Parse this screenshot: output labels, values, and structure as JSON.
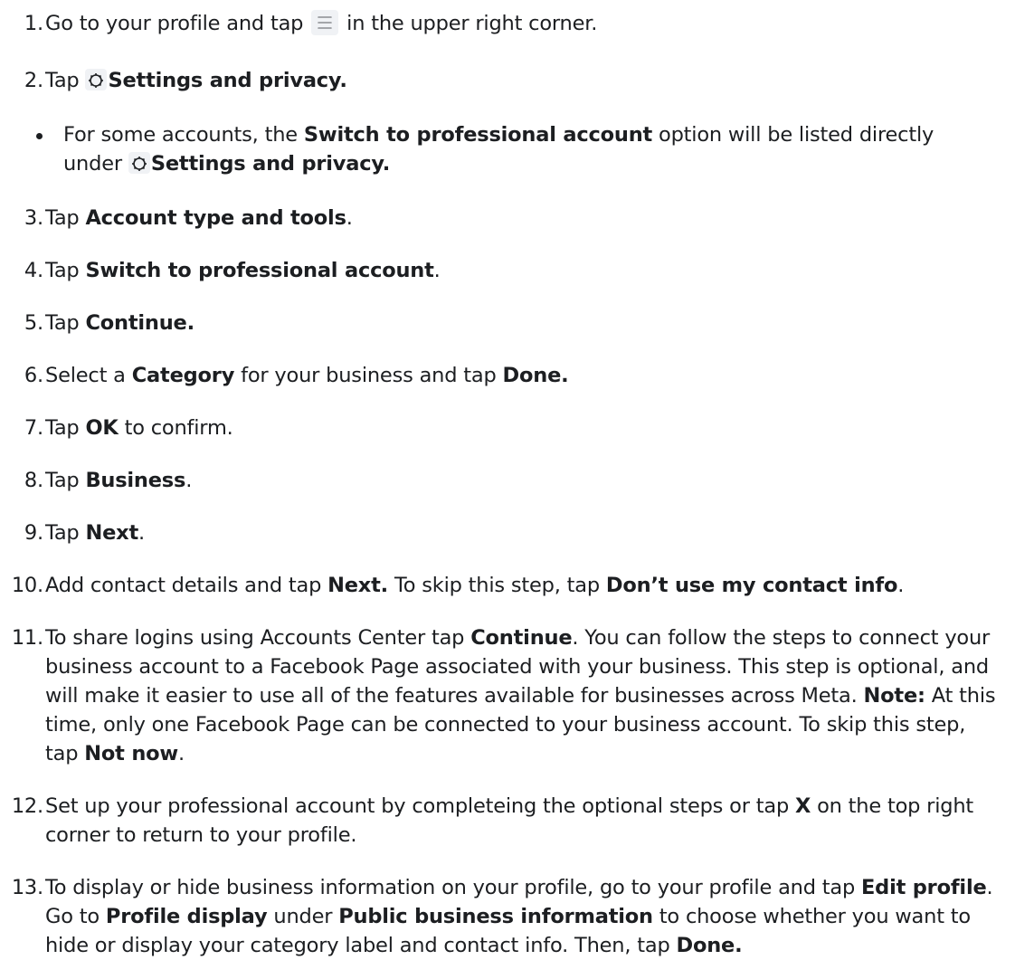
{
  "steps": [
    {
      "num": "1.",
      "a": "Go to your profile and tap ",
      "icon": "menu-icon",
      "b": " in the upper right corner."
    },
    {
      "num": "2.",
      "a": "Tap ",
      "icon": "gear-icon",
      "bold": "Settings and privacy."
    },
    {
      "num": "3.",
      "a": "Tap ",
      "bold": "Account type and tools",
      "b": "."
    },
    {
      "num": "4.",
      "a": "Tap ",
      "bold": "Switch to professional account",
      "b": "."
    },
    {
      "num": "5.",
      "a": "Tap ",
      "bold": "Continue."
    },
    {
      "num": "6.",
      "a": "Select a ",
      "bold1": "Category",
      "b": " for your business and tap ",
      "bold2": "Done."
    },
    {
      "num": "7.",
      "a": "Tap ",
      "bold": "OK",
      "b": " to confirm."
    },
    {
      "num": "8.",
      "a": "Tap ",
      "bold": "Business",
      "b": "."
    },
    {
      "num": "9.",
      "a": "Tap ",
      "bold": "Next",
      "b": "."
    },
    {
      "num": "10.",
      "a": "Add contact details and tap ",
      "bold1": "Next.",
      "b": " To skip this step, tap ",
      "bold2": "Don’t use my contact info",
      "c": "."
    },
    {
      "num": "11.",
      "a": "To share logins using Accounts Center tap ",
      "bold1": "Continue",
      "b": ". You can follow the steps to connect your business account to a Facebook Page associated with your business. This step is optional, and will make it easier to use all of the features available for businesses across Meta. ",
      "bold2": "Note:",
      "c": " At this time, only one Facebook Page can be connected to your business account. To skip this step, tap ",
      "bold3": "Not now",
      "d": "."
    },
    {
      "num": "12.",
      "a": "Set up your professional account by completeing the optional steps or tap ",
      "bold": "X",
      "b": " on the top right corner to return to your profile."
    },
    {
      "num": "13.",
      "a": "To display or hide business information on your profile, go to your profile and tap ",
      "bold1": "Edit profile",
      "b": ". Go to ",
      "bold2": "Profile display",
      "c": " under ",
      "bold3": "Public business information",
      "d": " to choose whether you want to hide or display your category label and contact info. Then, tap ",
      "bold4": "Done."
    }
  ],
  "sub_bullet": {
    "a": "For some accounts, the ",
    "bold1": "Switch to professional account",
    "b": " option will be listed directly under ",
    "icon": "gear-icon",
    "bold2": "Settings and privacy."
  }
}
